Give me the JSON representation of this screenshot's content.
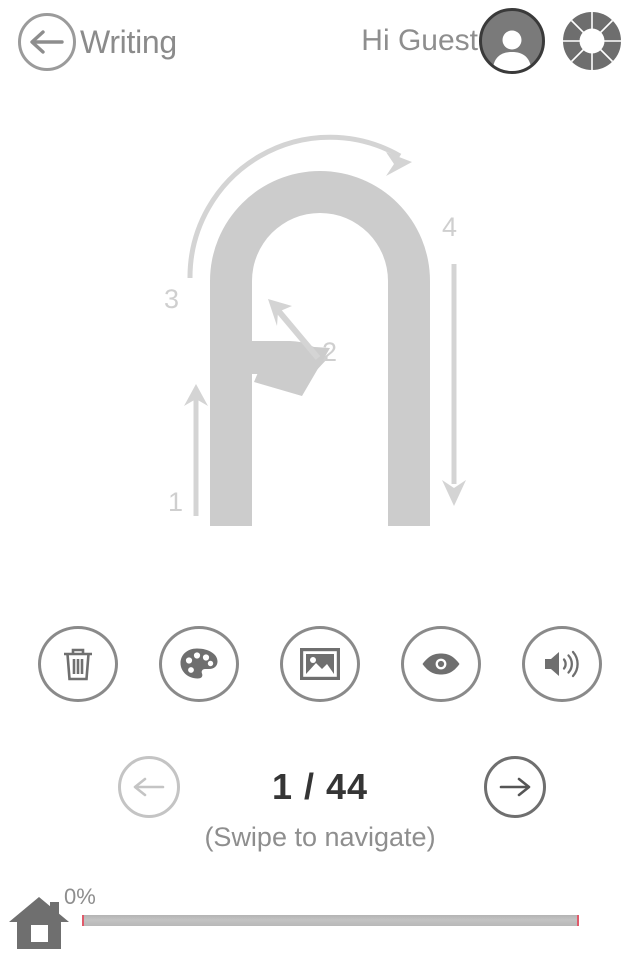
{
  "header": {
    "back_icon": "arrow-left-icon",
    "title": "Writing",
    "greeting": "Hi Guest",
    "avatar_icon": "user-avatar-icon",
    "wheel_icon": "color-wheel-icon"
  },
  "character": {
    "name": "stroke-order-diagram",
    "stroke_count": 4,
    "stroke_labels": [
      "1",
      "2",
      "3",
      "4"
    ],
    "stroke_color": "#cccccc",
    "label_color": "#cfcfcf"
  },
  "toolbar": {
    "buttons": [
      {
        "name": "clear-button",
        "icon": "trash-icon"
      },
      {
        "name": "color-button",
        "icon": "palette-icon"
      },
      {
        "name": "image-button",
        "icon": "image-icon"
      },
      {
        "name": "show-button",
        "icon": "eye-icon"
      },
      {
        "name": "sound-button",
        "icon": "speaker-icon"
      }
    ]
  },
  "navigation": {
    "prev_icon": "arrow-left-icon",
    "next_icon": "arrow-right-icon",
    "counter": "1 / 44",
    "current": 1,
    "total": 44,
    "hint": "(Swipe to navigate)"
  },
  "footer": {
    "home_icon": "home-icon",
    "progress_label": "0%",
    "progress_percent": 0,
    "progress_accent": "#e05a6a"
  }
}
